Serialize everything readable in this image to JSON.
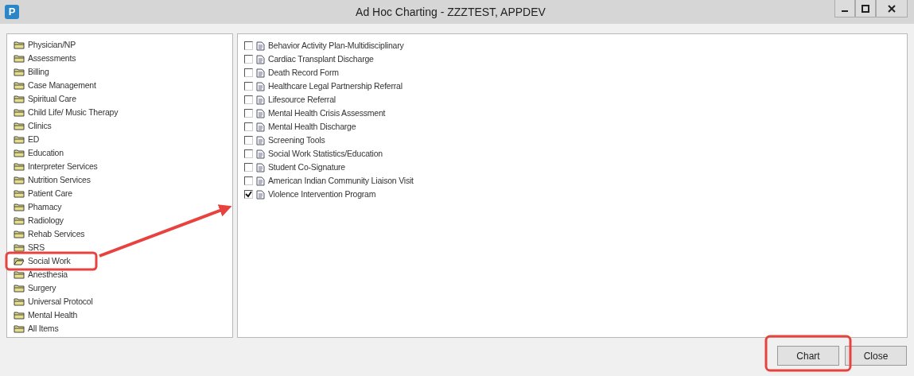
{
  "window": {
    "logo": "P",
    "title": "Ad Hoc Charting - ZZZTEST, APPDEV"
  },
  "folders": [
    {
      "label": "Physician/NP",
      "selected": false
    },
    {
      "label": "Assessments",
      "selected": false
    },
    {
      "label": "Billing",
      "selected": false
    },
    {
      "label": "Case Management",
      "selected": false
    },
    {
      "label": "Spiritual Care",
      "selected": false
    },
    {
      "label": "Child Life/ Music Therapy",
      "selected": false
    },
    {
      "label": "Clinics",
      "selected": false
    },
    {
      "label": "ED",
      "selected": false
    },
    {
      "label": "Education",
      "selected": false
    },
    {
      "label": "Interpreter Services",
      "selected": false
    },
    {
      "label": "Nutrition Services",
      "selected": false
    },
    {
      "label": "Patient Care",
      "selected": false
    },
    {
      "label": "Phamacy",
      "selected": false
    },
    {
      "label": "Radiology",
      "selected": false
    },
    {
      "label": "Rehab Services",
      "selected": false
    },
    {
      "label": "SRS",
      "selected": false
    },
    {
      "label": "Social Work",
      "selected": true
    },
    {
      "label": "Anesthesia",
      "selected": false
    },
    {
      "label": "Surgery",
      "selected": false
    },
    {
      "label": "Universal Protocol",
      "selected": false
    },
    {
      "label": "Mental Health",
      "selected": false
    },
    {
      "label": "All Items",
      "selected": false
    }
  ],
  "forms": [
    {
      "label": "Behavior Activity Plan-Multidisciplinary",
      "checked": false
    },
    {
      "label": "Cardiac Transplant Discharge",
      "checked": false
    },
    {
      "label": "Death Record Form",
      "checked": false
    },
    {
      "label": "Healthcare Legal Partnership Referral",
      "checked": false
    },
    {
      "label": "Lifesource Referral",
      "checked": false
    },
    {
      "label": "Mental Health Crisis Assessment",
      "checked": false
    },
    {
      "label": "Mental Health Discharge",
      "checked": false
    },
    {
      "label": "Screening Tools",
      "checked": false
    },
    {
      "label": "Social Work Statistics/Education",
      "checked": false
    },
    {
      "label": "Student Co-Signature",
      "checked": false
    },
    {
      "label": "American Indian Community Liaison Visit",
      "checked": false
    },
    {
      "label": "Violence Intervention Program",
      "checked": true
    }
  ],
  "buttons": [
    "Chart",
    "Close"
  ]
}
